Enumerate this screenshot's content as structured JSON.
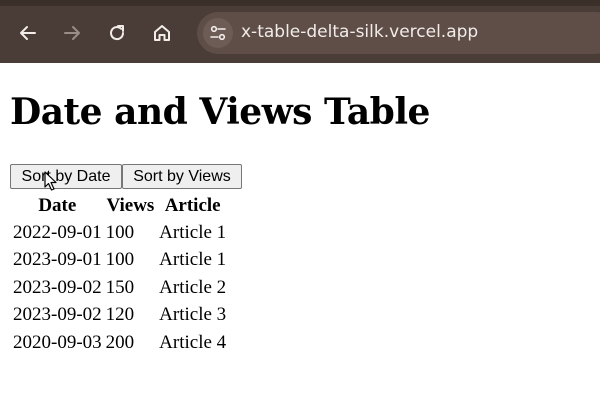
{
  "browser": {
    "url": "x-table-delta-silk.vercel.app",
    "icons": [
      "back-arrow-icon",
      "forward-arrow-icon",
      "reload-icon",
      "home-icon",
      "site-settings-icon"
    ]
  },
  "page": {
    "title": "Date and Views Table",
    "buttons": {
      "sort_date": "Sort by Date",
      "sort_views": "Sort by Views"
    },
    "table": {
      "headers": [
        "Date",
        "Views",
        "Article"
      ],
      "rows": [
        [
          "2022-09-01",
          "100",
          "Article 1"
        ],
        [
          "2023-09-01",
          "100",
          "Article 1"
        ],
        [
          "2023-09-02",
          "150",
          "Article 2"
        ],
        [
          "2023-09-02",
          "120",
          "Article 3"
        ],
        [
          "2020-09-03",
          "200",
          "Article 4"
        ]
      ]
    }
  },
  "colors": {
    "chrome_background": "#4a3c36",
    "omnibox_background": "#5e4e47"
  }
}
